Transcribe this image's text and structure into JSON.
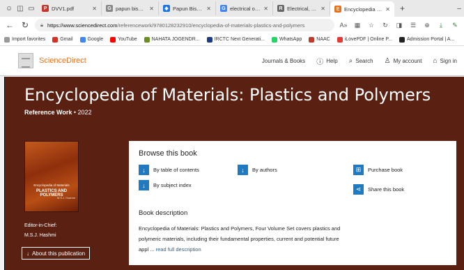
{
  "browser": {
    "tabs": [
      {
        "title": "DVV1.pdf",
        "color": "#c8332b",
        "glyph": "P"
      },
      {
        "title": "papun biswas goog",
        "color": "#888888",
        "glyph": "G"
      },
      {
        "title": "Papun Biswas - Goo",
        "color": "#1a73e8",
        "glyph": "◆"
      },
      {
        "title": "electrical optical anc",
        "color": "#4285f4",
        "glyph": "G"
      },
      {
        "title": "Electrical, Optical an",
        "color": "#666666",
        "glyph": "R"
      },
      {
        "title": "Encyclopedia of Mat",
        "color": "#e9711c",
        "glyph": "E"
      }
    ],
    "new_tab": "+",
    "url_host": "https://www.sciencedirect.com",
    "url_path": "/referencework/9780128232910/encyclopedia-of-materials-plastics-and-polymers",
    "favorites": [
      {
        "label": "Import favorites",
        "color": "#999999"
      },
      {
        "label": "Gmail",
        "color": "#d93025"
      },
      {
        "label": "Google",
        "color": "#4285f4"
      },
      {
        "label": "YouTube",
        "color": "#ff0000"
      },
      {
        "label": "NAHATA JOGENDR...",
        "color": "#6b8e23"
      },
      {
        "label": "IRCTC Next Generati...",
        "color": "#1e3a8a"
      },
      {
        "label": "WhatsApp",
        "color": "#25d366"
      },
      {
        "label": "NAAC",
        "color": "#c0392b"
      },
      {
        "label": "iLovePDF | Online P...",
        "color": "#e53935"
      },
      {
        "label": "Admission Portal | A...",
        "color": "#222222"
      }
    ]
  },
  "site": {
    "logo": "ScienceDirect",
    "nav": {
      "journals": "Journals & Books",
      "help": "Help",
      "search": "Search",
      "account": "My account",
      "signin": "Sign in"
    }
  },
  "hero": {
    "title": "Encyclopedia of Materials: Plastics and Polymers",
    "type": "Reference Work",
    "year": "• 2022",
    "cover_series": "Encyclopedia of Materials",
    "cover_title": "PLASTICS AND POLYMERS",
    "cover_editor": "M.S.J. Hashmi",
    "editor_label": "Editor-in-Chief:",
    "editor_name": "M.S.J. Hashmi",
    "about_btn": "About this publication"
  },
  "browse": {
    "heading": "Browse this book",
    "toc": "By table of contents",
    "authors": "By authors",
    "purchase": "Purchase book",
    "subject": "By subject index",
    "share": "Share this book",
    "desc_heading": "Book description",
    "desc_text": "Encyclopedia of Materials: Plastics and Polymers, Four Volume Set covers plastics and polymeric materials, including their fundamental properties, current and potential future appl ...",
    "read_more": "read full description"
  }
}
